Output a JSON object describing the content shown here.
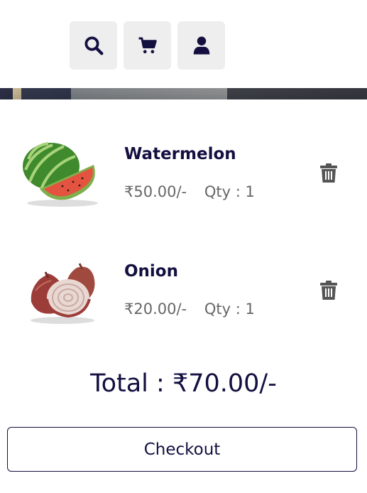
{
  "header": {
    "icons": [
      "search-icon",
      "cart-icon",
      "user-icon"
    ]
  },
  "cart": {
    "items": [
      {
        "name": "Watermelon",
        "price": "₹50.00/-",
        "qty": "Qty : 1",
        "image": "watermelon-image"
      },
      {
        "name": "Onion",
        "price": "₹20.00/-",
        "qty": "Qty : 1",
        "image": "onion-image"
      }
    ],
    "total": "Total : ₹70.00/-",
    "checkout_label": "Checkout"
  },
  "colors": {
    "primary_text": "#130f40",
    "muted_text": "#666666",
    "icon_button_bg": "#eeeeee",
    "trash_icon": "#555555"
  }
}
